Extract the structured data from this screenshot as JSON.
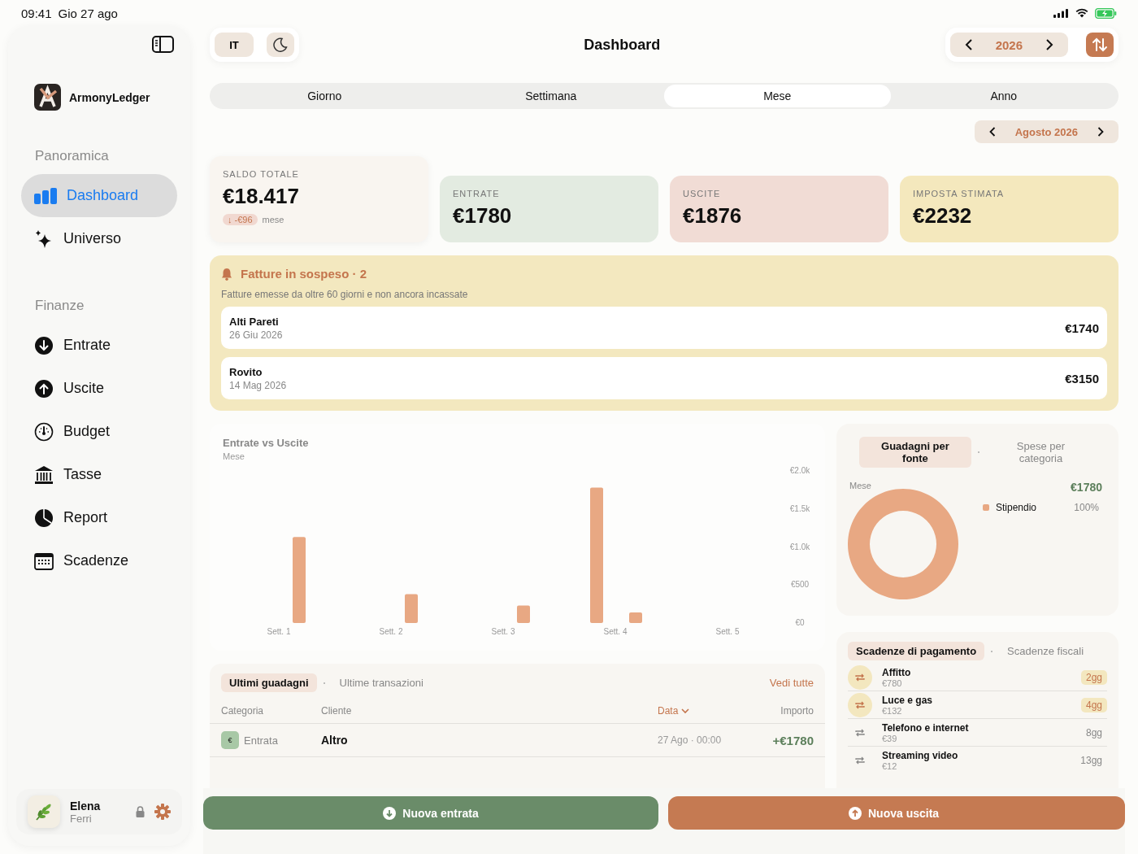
{
  "status_bar": {
    "time": "09:41",
    "date": "Gio 27 ago"
  },
  "sidebar": {
    "app_name": "ArmonyLedger",
    "sections": [
      {
        "title": "Panoramica",
        "items": [
          {
            "label": "Dashboard",
            "selected": true
          },
          {
            "label": "Universo",
            "selected": false
          }
        ]
      },
      {
        "title": "Finanze",
        "items": [
          {
            "label": "Entrate",
            "selected": false
          },
          {
            "label": "Uscite",
            "selected": false
          },
          {
            "label": "Budget",
            "selected": false
          },
          {
            "label": "Tasse",
            "selected": false
          },
          {
            "label": "Report",
            "selected": false
          },
          {
            "label": "Scadenze",
            "selected": false
          }
        ]
      }
    ],
    "user": {
      "first_name": "Elena",
      "last_name": "Ferri"
    }
  },
  "header": {
    "language": "IT",
    "title": "Dashboard",
    "year": "2026"
  },
  "period_tabs": [
    {
      "label": "Giorno",
      "selected": false
    },
    {
      "label": "Settimana",
      "selected": false
    },
    {
      "label": "Mese",
      "selected": true
    },
    {
      "label": "Anno",
      "selected": false
    }
  ],
  "month": "Agosto 2026",
  "stats": [
    {
      "label": "SALDO TOTALE",
      "value": "€18.417",
      "color": "#f9f5f0",
      "delta": "↓ -€96",
      "delta_note": "mese"
    },
    {
      "label": "ENTRATE",
      "value": "€1780",
      "color": "#e3ebe1"
    },
    {
      "label": "USCITE",
      "value": "€1876",
      "color": "#f1dcd5"
    },
    {
      "label": "IMPOSTA STIMATA",
      "value": "€2232",
      "color": "#f4e8bd"
    }
  ],
  "pending_invoices": {
    "title": "Fatture in sospeso · 2",
    "subtitle": "Fatture emesse da oltre 60 giorni e non ancora incassate",
    "items": [
      {
        "client": "Alti Pareti",
        "date": "26 Giu 2026",
        "amount": "€1740"
      },
      {
        "client": "Rovito",
        "date": "14 Mag 2026",
        "amount": "€3150"
      }
    ]
  },
  "cashflow_chart": {
    "subtitle": "Mese",
    "chart_data": {
      "type": "bar",
      "title": "Entrate vs Uscite",
      "categories": [
        "Sett. 1",
        "Sett. 2",
        "Sett. 3",
        "Sett. 4",
        "Sett. 5"
      ],
      "series": [
        {
          "color": "#e8a883",
          "values": [
            0,
            0,
            0,
            1780,
            0
          ]
        },
        {
          "color": "#e8a883",
          "values": [
            1130,
            380,
            230,
            140,
            0
          ]
        }
      ],
      "ylim": [
        0,
        2000
      ],
      "yticks": [
        {
          "value": 0,
          "label": "€0"
        },
        {
          "value": 500,
          "label": "€500"
        },
        {
          "value": 1000,
          "label": "€1.0k"
        },
        {
          "value": 1500,
          "label": "€1.5k"
        },
        {
          "value": 2000,
          "label": "€2.0k"
        }
      ]
    }
  },
  "sources_panel": {
    "tabs": [
      {
        "label": "Guadagni per fonte",
        "selected": true
      },
      {
        "label": "Spese per categoria",
        "selected": false
      }
    ],
    "period": "Mese",
    "total": "€1780",
    "legend": [
      {
        "label": "Stipendio",
        "value": "100%",
        "color": "#e8a883"
      }
    ]
  },
  "transactions": {
    "tabs": [
      {
        "label": "Ultimi guadagni",
        "selected": true
      },
      {
        "label": "Ultime transazioni",
        "selected": false
      }
    ],
    "link": "Vedi tutte",
    "columns": [
      {
        "label": "Categoria",
        "sorted": false
      },
      {
        "label": "Cliente",
        "sorted": false
      },
      {
        "label": "Data",
        "sorted": true
      },
      {
        "label": "Importo",
        "sorted": false
      }
    ],
    "rows": [
      {
        "badge": "€",
        "category": "Entrata",
        "client": "Altro",
        "date": "27 Ago · 00:00",
        "amount": "+€1780"
      }
    ]
  },
  "deadlines": {
    "tabs": [
      {
        "label": "Scadenze di pagamento",
        "selected": true
      },
      {
        "label": "Scadenze fiscali",
        "selected": false
      }
    ],
    "items": [
      {
        "name": "Affitto",
        "amount": "€780",
        "due": "2gg",
        "urgent": true
      },
      {
        "name": "Luce e gas",
        "amount": "€132",
        "due": "4gg",
        "urgent": true
      },
      {
        "name": "Telefono e internet",
        "amount": "€39",
        "due": "8gg",
        "urgent": false
      },
      {
        "name": "Streaming video",
        "amount": "€12",
        "due": "13gg",
        "urgent": false
      }
    ]
  },
  "actions": [
    {
      "label": "Nuova entrata",
      "kind": "income"
    },
    {
      "label": "Nuova uscita",
      "kind": "expense"
    }
  ]
}
